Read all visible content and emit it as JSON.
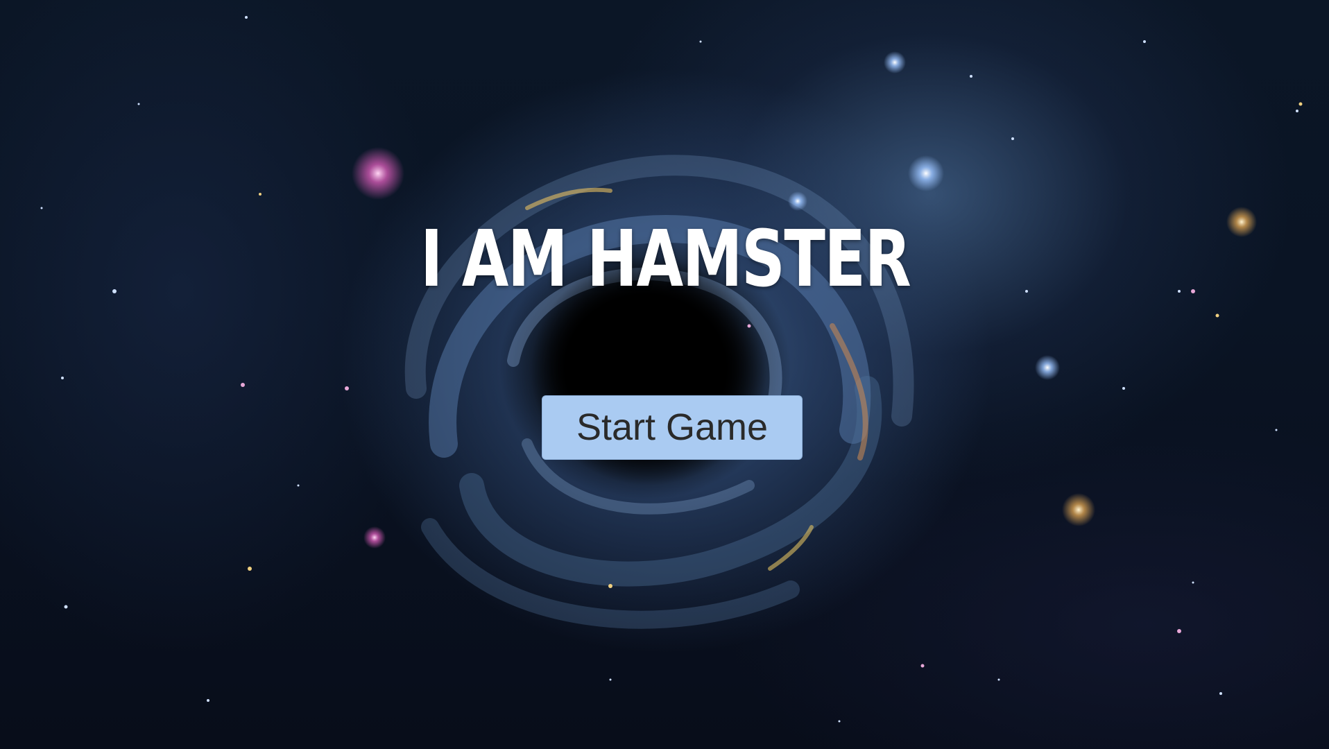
{
  "title": "I AM HAMSTER",
  "start_button": {
    "label": "Start Game"
  },
  "colors": {
    "title": "#ffffff",
    "button_bg": "#aacbf2",
    "button_text": "#2a2a2a",
    "space_bg": "#0a1424"
  },
  "background": {
    "icon": "galaxy-black-hole-image"
  }
}
